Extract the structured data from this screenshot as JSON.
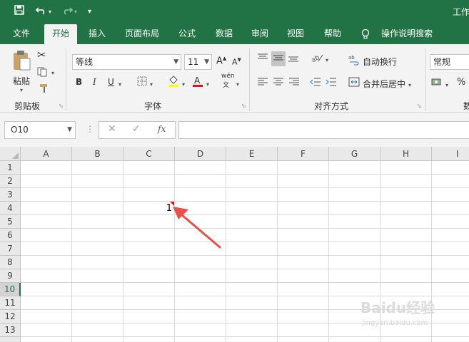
{
  "app": {
    "title": "工作"
  },
  "ribbon_tabs": [
    "文件",
    "开始",
    "插入",
    "页面布局",
    "公式",
    "数据",
    "审阅",
    "视图",
    "帮助",
    "操作说明搜索"
  ],
  "active_tab": "开始",
  "clipboard": {
    "paste_label": "粘贴",
    "group_label": "剪贴板"
  },
  "font": {
    "name": "等线",
    "size": "11",
    "bold": "B",
    "italic": "I",
    "underline": "U",
    "phonetic": "wén",
    "group_label": "字体"
  },
  "alignment": {
    "wrap_text": "自动换行",
    "merge_center": "合并后居中",
    "group_label": "对齐方式"
  },
  "number": {
    "format": "常规",
    "percent": "%",
    "group_label_partial": "数"
  },
  "formula_bar": {
    "name_box": "O10",
    "cancel": "✕",
    "enter": "✓",
    "fx": "fx",
    "formula": ""
  },
  "grid": {
    "columns": [
      "A",
      "B",
      "C",
      "D",
      "E",
      "F",
      "G",
      "H",
      "I"
    ],
    "rows": [
      "1",
      "2",
      "3",
      "4",
      "5",
      "6",
      "7",
      "8",
      "9",
      "10",
      "11",
      "12",
      "13"
    ],
    "active_row": "10",
    "cells": {
      "C4": "1"
    },
    "comment_cell": "C4"
  },
  "colors": {
    "excel_green": "#217346",
    "comment_marker": "#e0141e",
    "annotation_arrow": "#e8514a",
    "font_color": "#e0141e",
    "highlight": "#ffff00"
  },
  "watermark": {
    "text": "Baidu经验",
    "subtext": "jingyan.baidu.com"
  }
}
